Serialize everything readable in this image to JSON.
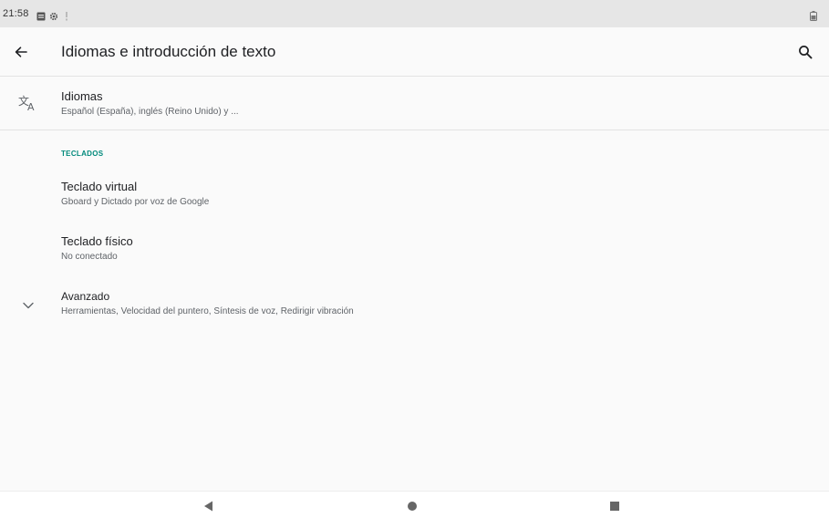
{
  "status_bar": {
    "time": "21:58",
    "icons": [
      "image-notification-icon",
      "settings-notification-icon",
      "alert-notification-icon",
      "battery-icon"
    ]
  },
  "app_bar": {
    "title": "Idiomas e introducción de texto",
    "back_icon": "arrow-back-icon",
    "search_icon": "search-icon"
  },
  "languages": {
    "icon": "translate-icon",
    "title": "Idiomas",
    "summary": "Español (España), inglés (Reino Unido) y ..."
  },
  "keyboards": {
    "header": "TECLADOS",
    "virtual": {
      "title": "Teclado virtual",
      "summary": "Gboard y Dictado por voz de Google"
    },
    "physical": {
      "title": "Teclado físico",
      "summary": "No conectado"
    }
  },
  "advanced": {
    "icon": "chevron-down-icon",
    "title": "Avanzado",
    "summary": "Herramientas, Velocidad del puntero, Síntesis de voz, Redirigir vibración"
  },
  "nav_bar": {
    "buttons": [
      "back-triangle-icon",
      "home-circle-icon",
      "recents-square-icon"
    ]
  },
  "colors": {
    "accent": "#00897b",
    "status_bar": "#e6e6e6",
    "background": "#fafafa"
  }
}
